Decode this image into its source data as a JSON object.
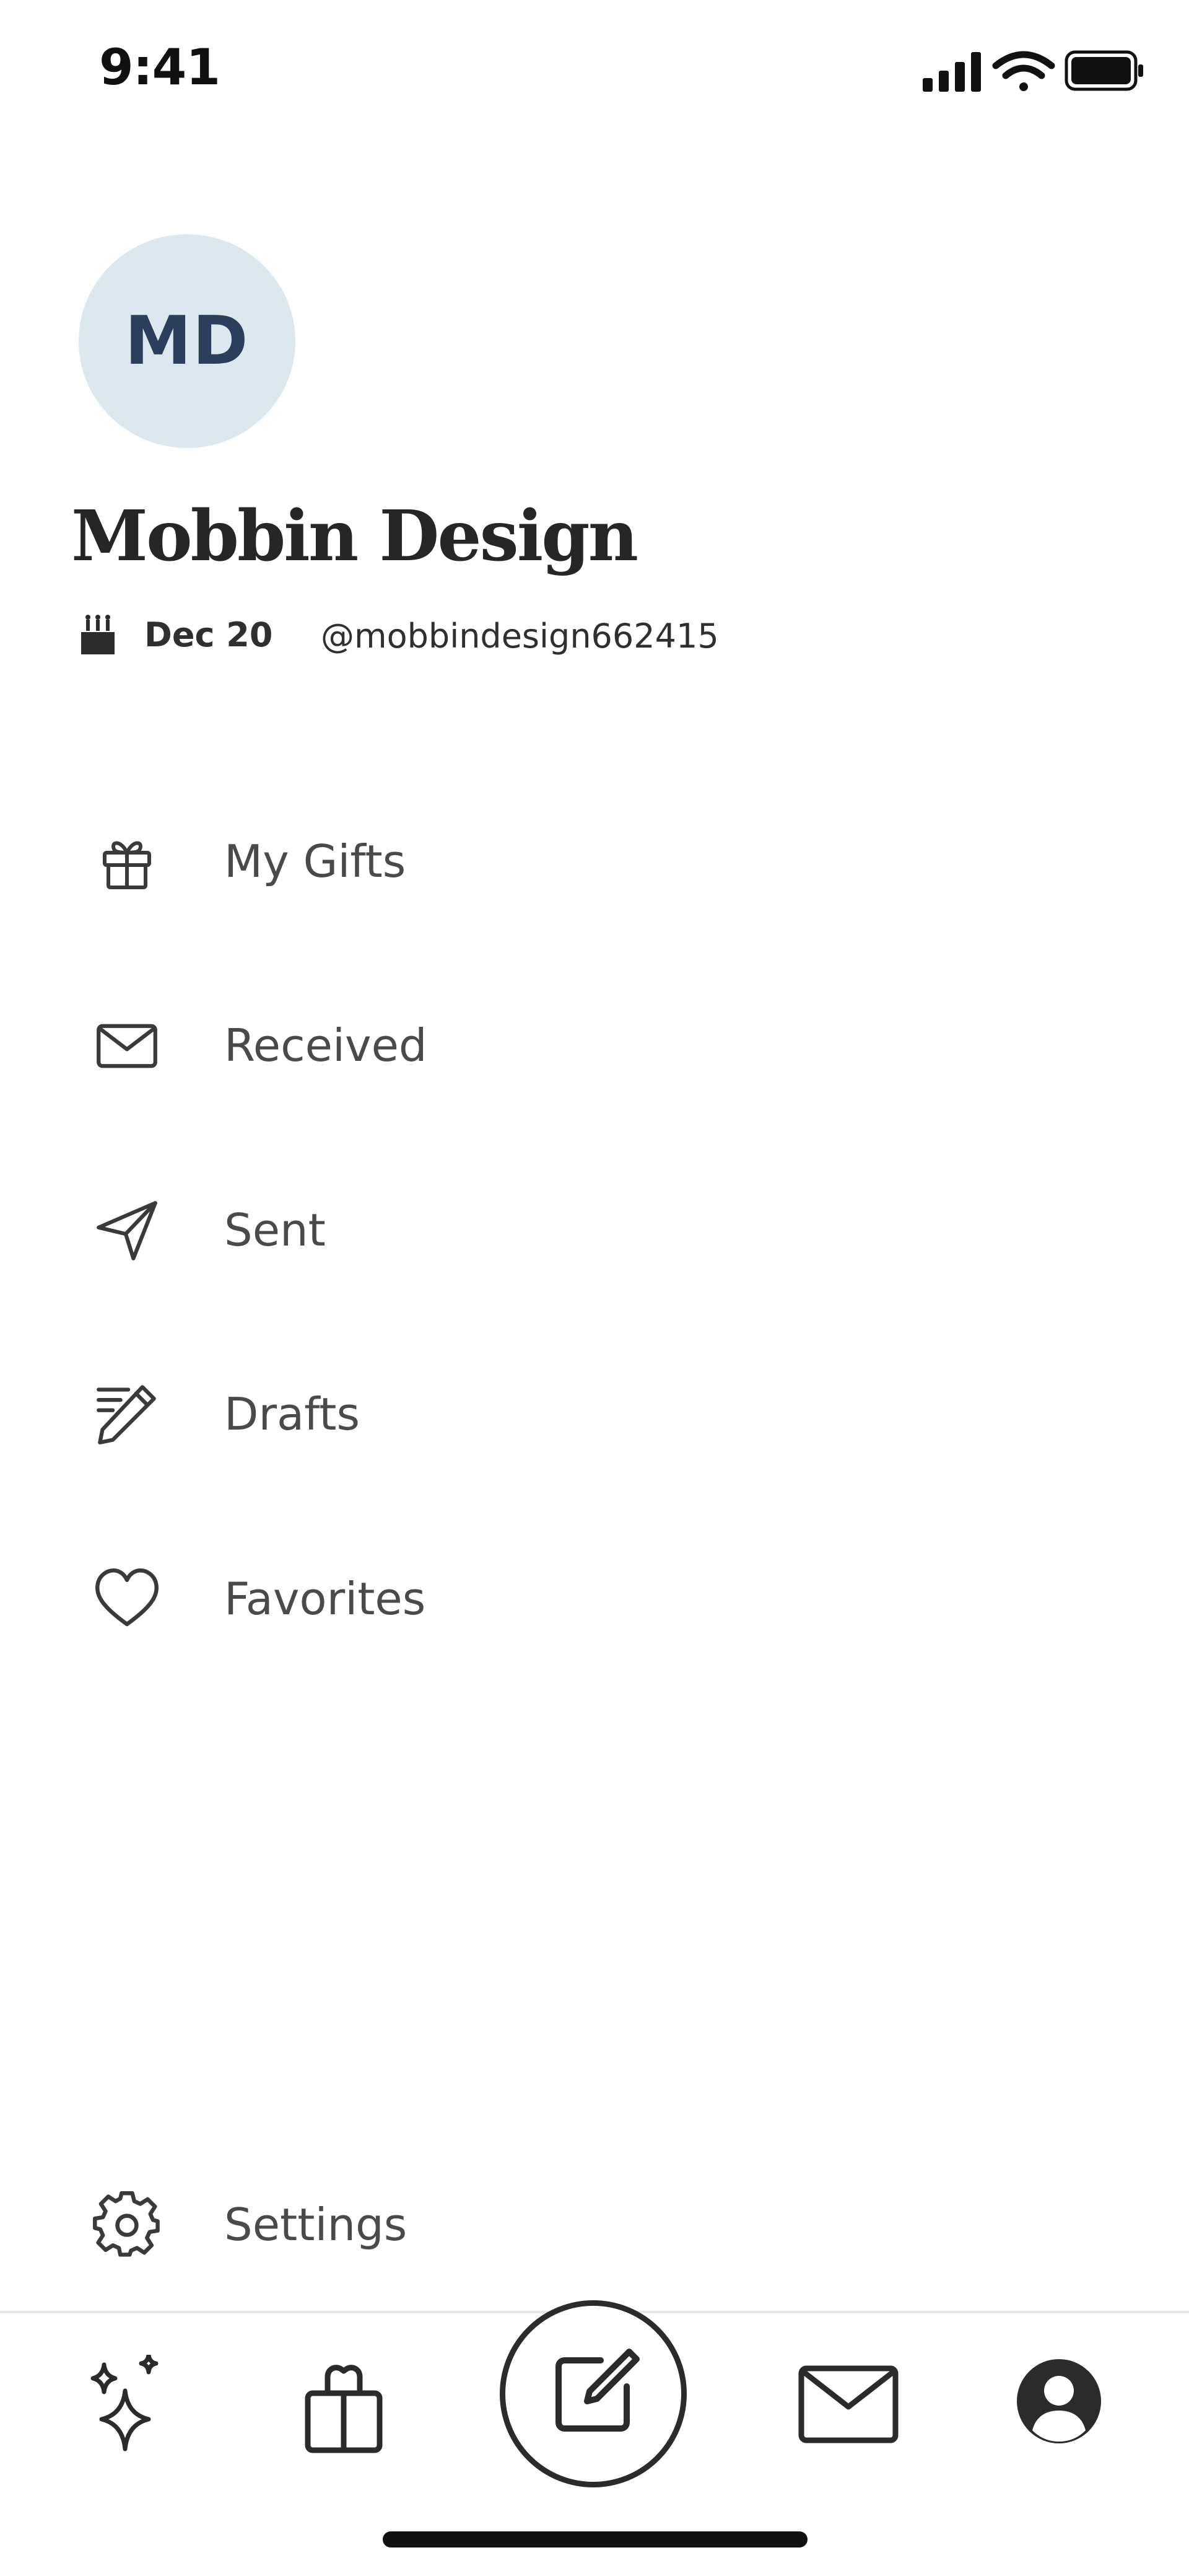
{
  "status_bar": {
    "time": "9:41"
  },
  "profile": {
    "initials": "MD",
    "name": "Mobbin Design",
    "birthday": "Dec 20",
    "handle": "@mobbindesign662415"
  },
  "menu": {
    "items": [
      {
        "label": "My Gifts",
        "icon": "gift-icon"
      },
      {
        "label": "Received",
        "icon": "envelope-icon"
      },
      {
        "label": "Sent",
        "icon": "paper-plane-icon"
      },
      {
        "label": "Drafts",
        "icon": "pencil-icon"
      },
      {
        "label": "Favorites",
        "icon": "heart-icon"
      }
    ],
    "settings_label": "Settings"
  },
  "tab_bar": {
    "tabs": [
      "sparkles-icon",
      "gift-bag-icon",
      "compose-icon",
      "mail-icon",
      "profile-icon"
    ]
  },
  "colors": {
    "avatar_bg": "#dce7ee",
    "avatar_text": "#2c3e5c",
    "text_primary": "#262626",
    "text_menu": "#4a4a4a"
  }
}
